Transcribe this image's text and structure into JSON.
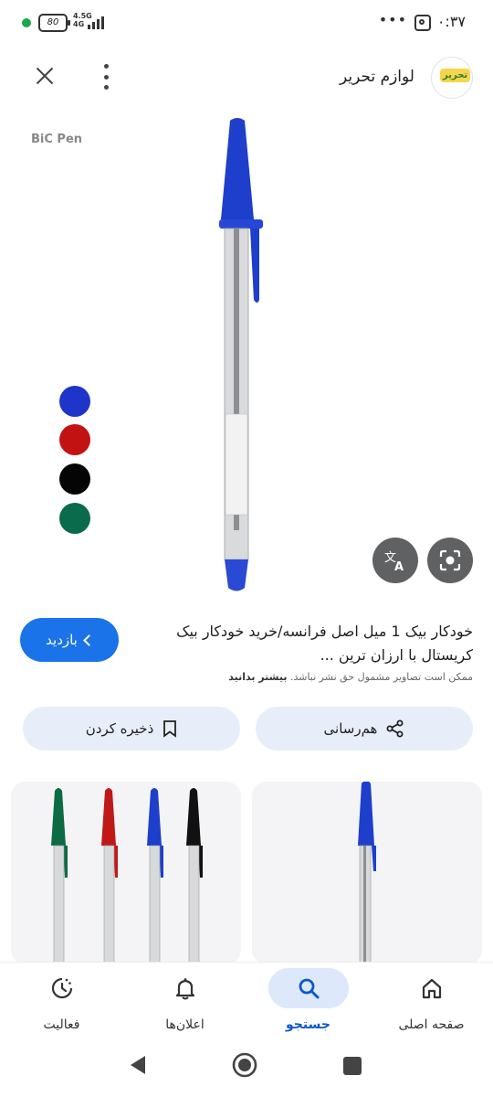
{
  "status_bar": {
    "time": "۰:۳۷",
    "battery": "80",
    "network": "4.5G",
    "network_sub": "4G",
    "more": "•••"
  },
  "header": {
    "site_name": "لوازم تحریر",
    "logo_text": "تحریر"
  },
  "image": {
    "brand_label": "BiC Pen",
    "swatch_colors": [
      "#1f35c9",
      "#c21212",
      "#050505",
      "#0a6b4c"
    ],
    "pen_color": "#1a3ec9"
  },
  "result": {
    "title": "خودکار بیک 1 میل اصل فرانسه/خرید خودکار بیک کریستال با ارزان ترین ...",
    "copyright_notice": "ممکن است تصاویر مشمول حق نشر نباشد.",
    "learn_more": "بیشتر بدانید",
    "visit_label": "بازدید"
  },
  "actions": {
    "share_label": "هم‌رسانی",
    "save_label": "ذخیره کردن"
  },
  "bottom_nav": {
    "items": [
      {
        "label": "صفحه اصلی",
        "icon": "home-icon"
      },
      {
        "label": "جستجو",
        "icon": "search-icon",
        "active": true
      },
      {
        "label": "اعلان‌ها",
        "icon": "bell-icon"
      },
      {
        "label": "فعالیت",
        "icon": "activity-icon"
      }
    ]
  },
  "colors": {
    "accent": "#1a73e8",
    "nav_active": "#0b57d0",
    "pill_bg": "#e8eef9"
  }
}
